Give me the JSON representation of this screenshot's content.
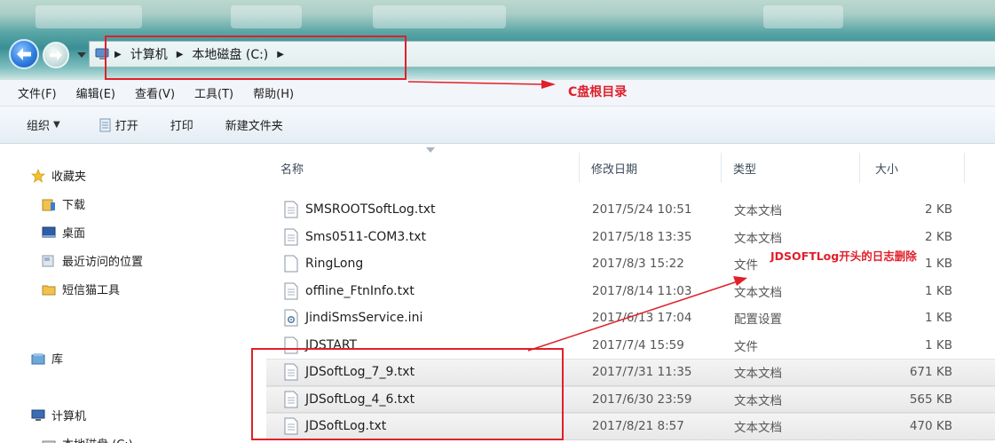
{
  "address": {
    "crumbs": [
      "计算机",
      "本地磁盘 (C:)"
    ]
  },
  "menu": [
    "文件(F)",
    "编辑(E)",
    "查看(V)",
    "工具(T)",
    "帮助(H)"
  ],
  "toolbar": {
    "organize": "组织",
    "open": "打开",
    "print": "打印",
    "new_folder": "新建文件夹"
  },
  "nav": {
    "favorites": "收藏夹",
    "downloads": "下载",
    "desktop": "桌面",
    "recent": "最近访问的位置",
    "sms_tool": "短信猫工具",
    "libraries": "库",
    "computer": "计算机",
    "local_disk": "本地磁盘 (C:)"
  },
  "columns": {
    "name": "名称",
    "date": "修改日期",
    "type": "类型",
    "size": "大小"
  },
  "files": [
    {
      "name": "SMSROOTSoftLog.txt",
      "date": "2017/5/24 10:51",
      "type": "文本文档",
      "size": "2 KB",
      "icon": "text-file-icon",
      "selected": false
    },
    {
      "name": "Sms0511-COM3.txt",
      "date": "2017/5/18 13:35",
      "type": "文本文档",
      "size": "2 KB",
      "icon": "text-file-icon",
      "selected": false
    },
    {
      "name": "RingLong",
      "date": "2017/8/3 15:22",
      "type": "文件",
      "size": "1 KB",
      "icon": "blank-file-icon",
      "selected": false
    },
    {
      "name": "offline_FtnInfo.txt",
      "date": "2017/8/14 11:03",
      "type": "文本文档",
      "size": "1 KB",
      "icon": "text-file-icon",
      "selected": false
    },
    {
      "name": "JindiSmsService.ini",
      "date": "2017/6/13 17:04",
      "type": "配置设置",
      "size": "1 KB",
      "icon": "settings-file-icon",
      "selected": false
    },
    {
      "name": "JDSTART",
      "date": "2017/7/4 15:59",
      "type": "文件",
      "size": "1 KB",
      "icon": "blank-file-icon",
      "selected": false
    },
    {
      "name": "JDSoftLog_7_9.txt",
      "date": "2017/7/31 11:35",
      "type": "文本文档",
      "size": "671 KB",
      "icon": "text-file-icon",
      "selected": true
    },
    {
      "name": "JDSoftLog_4_6.txt",
      "date": "2017/6/30 23:59",
      "type": "文本文档",
      "size": "565 KB",
      "icon": "text-file-icon",
      "selected": true
    },
    {
      "name": "JDSoftLog.txt",
      "date": "2017/8/21 8:57",
      "type": "文本文档",
      "size": "470 KB",
      "icon": "text-file-icon",
      "selected": true
    }
  ],
  "annotations": {
    "root_label": "C盘根目录",
    "delete_label": "JDSOFTLog开头的日志删除"
  },
  "colors": {
    "annotation": "#e0202a",
    "title_bar": "#3a8f95"
  }
}
